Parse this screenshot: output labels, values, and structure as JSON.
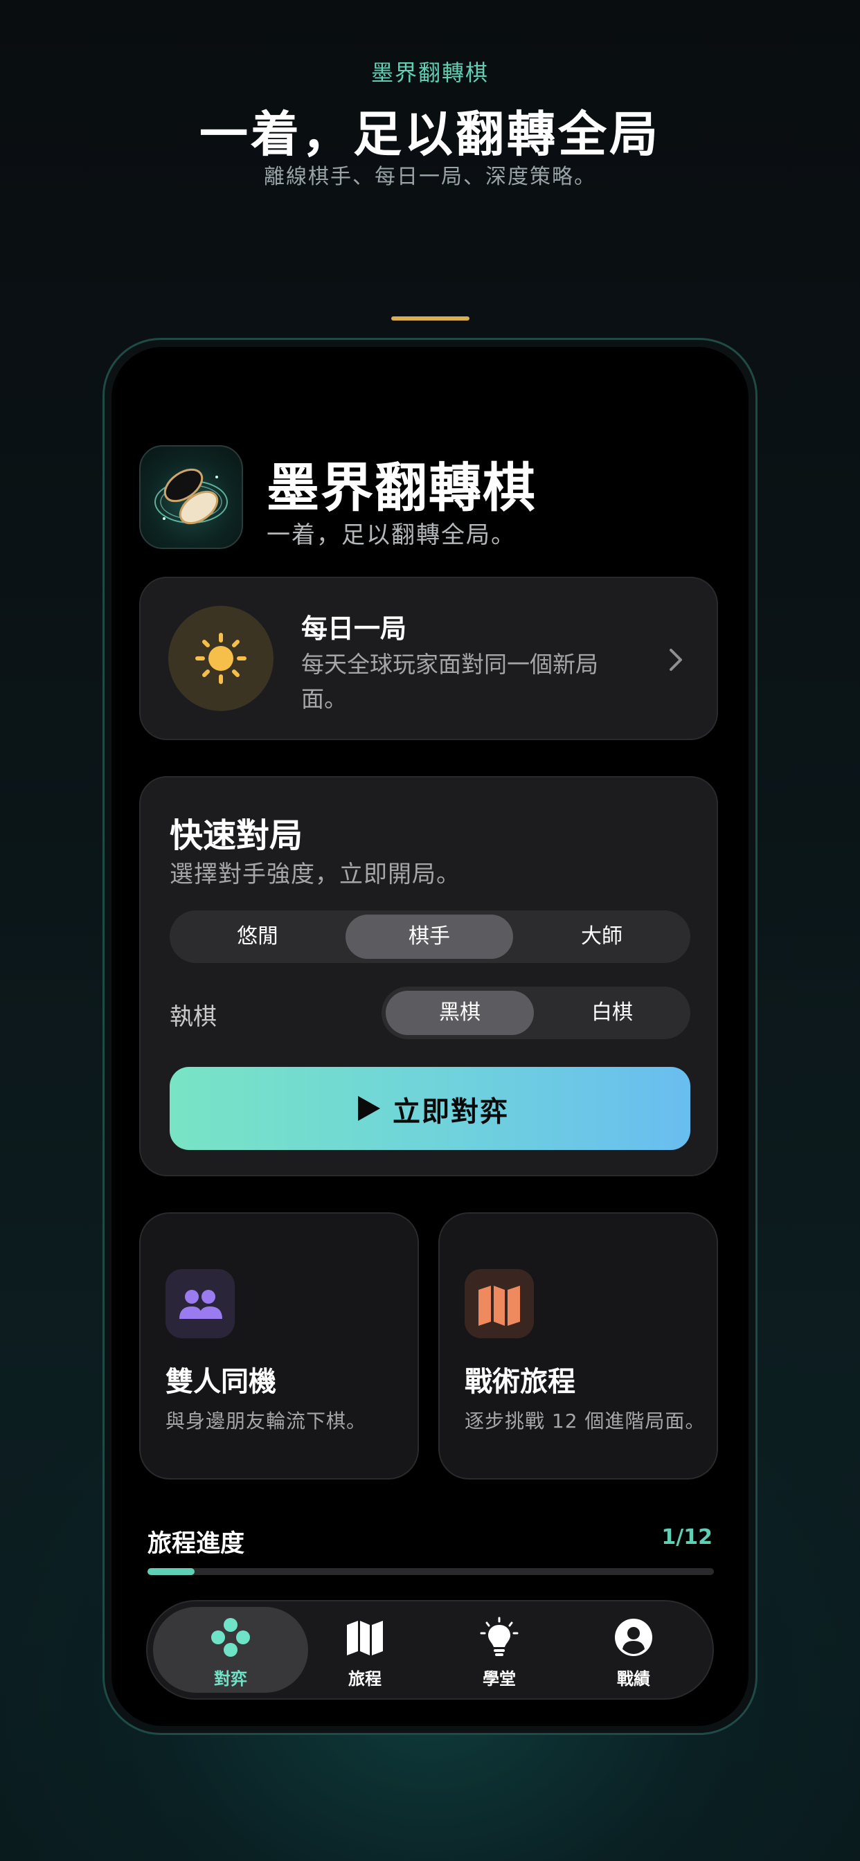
{
  "header": {
    "brand_tag": "墨界翻轉棋",
    "title": "一着，足以翻轉全局",
    "subtitle": "離線棋手、每日一局、深度策略。"
  },
  "app": {
    "name": "墨界翻轉棋",
    "tagline": "一着，足以翻轉全局。",
    "icon": "othello-discs-icon"
  },
  "daily": {
    "title": "每日一局",
    "description": "每天全球玩家面對同一個新局面。",
    "icon": "sun-icon"
  },
  "quick_match": {
    "title": "快速對局",
    "subtitle": "選擇對手強度，立即開局。",
    "difficulty_options": [
      "悠閒",
      "棋手",
      "大師"
    ],
    "difficulty_selected": "棋手",
    "side_label": "執棋",
    "side_options": [
      "黑棋",
      "白棋"
    ],
    "side_selected": "黑棋",
    "play_label": "立即對弈"
  },
  "features": [
    {
      "title": "雙人同機",
      "description": "與身邊朋友輪流下棋。",
      "icon": "people-icon",
      "accent": "#9b7cf0"
    },
    {
      "title": "戰術旅程",
      "description": "逐步挑戰 12 個進階局面。",
      "icon": "map-icon",
      "accent": "#ee8a5e"
    }
  ],
  "progress": {
    "label": "旅程進度",
    "count": "1/12",
    "fraction": 0.0833
  },
  "tabs": [
    {
      "label": "對弈",
      "icon": "gamepad-dots-icon",
      "active": true
    },
    {
      "label": "旅程",
      "icon": "map-icon",
      "active": false
    },
    {
      "label": "學堂",
      "icon": "lightbulb-icon",
      "active": false
    },
    {
      "label": "戰績",
      "icon": "profile-icon",
      "active": false
    }
  ],
  "colors": {
    "accent": "#5fd0b6",
    "gold": "#d9ad52",
    "play_gradient_start": "#78e4c4",
    "play_gradient_end": "#69bdf0"
  }
}
